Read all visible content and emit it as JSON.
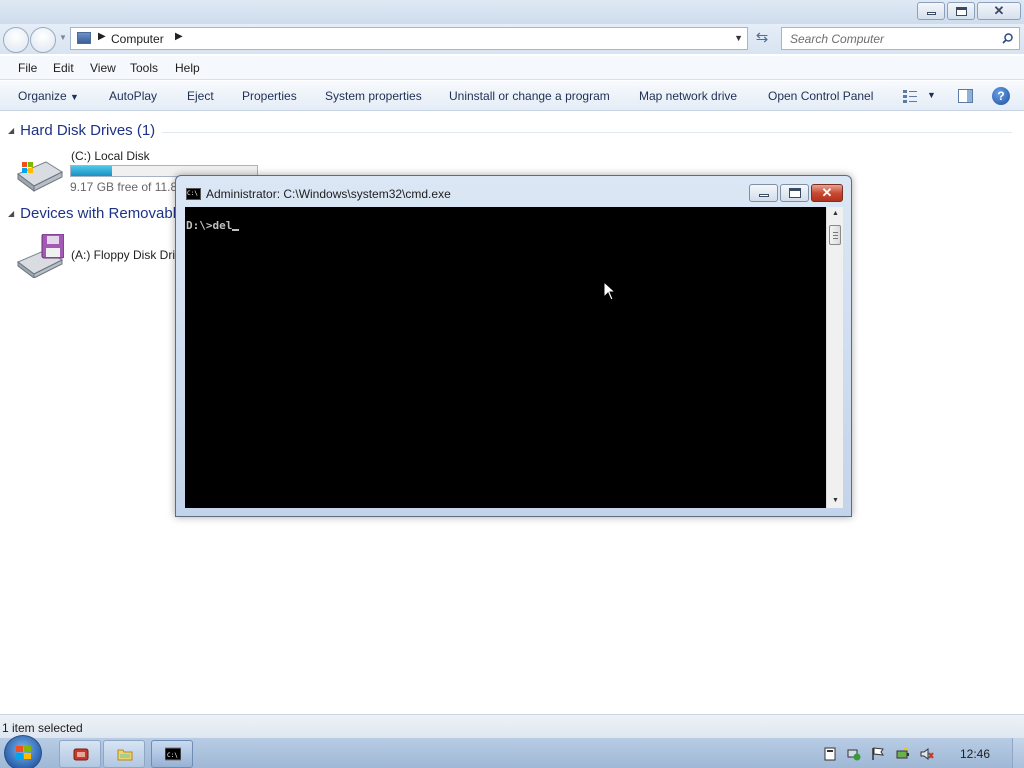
{
  "explorer": {
    "address": {
      "segments": [
        "Computer"
      ]
    },
    "search": {
      "placeholder": "Search Computer"
    },
    "menu": [
      "File",
      "Edit",
      "View",
      "Tools",
      "Help"
    ],
    "commands": [
      "Organize",
      "AutoPlay",
      "Eject",
      "Properties",
      "System properties",
      "Uninstall or change a program",
      "Map network drive",
      "Open Control Panel"
    ],
    "groups": [
      {
        "header": "Hard Disk Drives (1)",
        "drives": [
          {
            "name": "(C:) Local Disk",
            "free_text": "9.17 GB free of 11.8",
            "used_fraction": 0.22
          }
        ]
      },
      {
        "header": "Devices with Removabl",
        "drives": [
          {
            "name": "(A:) Floppy Disk Driv"
          }
        ]
      }
    ],
    "status": "1 item selected"
  },
  "cmd": {
    "title": "Administrator: C:\\Windows\\system32\\cmd.exe",
    "icon_text": "C:\\",
    "console_text": "D:\\>del"
  },
  "taskbar": {
    "clock": "12:46",
    "items": [
      "start-button",
      "media-app",
      "explorer-folder",
      "cmd-prompt"
    ],
    "tray": [
      "action-center-icon",
      "network-icon",
      "flag-icon",
      "power-icon",
      "volume-muted-icon"
    ]
  },
  "colors": {
    "link_blue": "#1e3287",
    "console_bg": "#000000",
    "console_fg": "#c0c0c0",
    "close_red": "#c94a33"
  }
}
